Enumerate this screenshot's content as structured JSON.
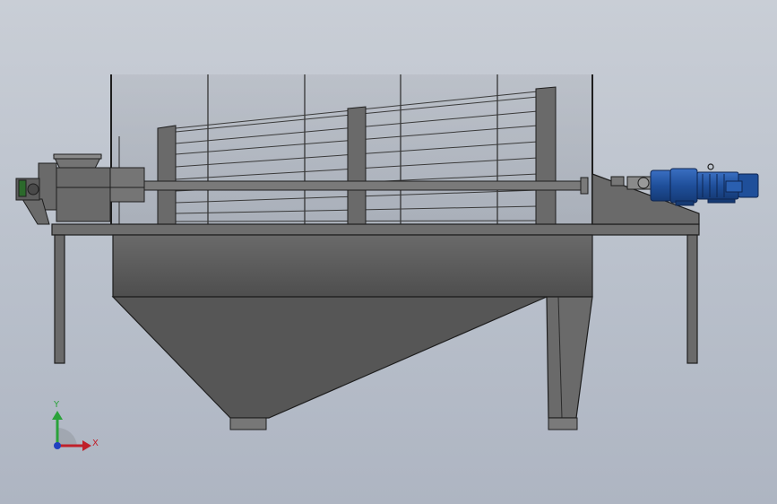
{
  "viewport": {
    "background_top": "#c9ced6",
    "background_bottom": "#aeb5c2"
  },
  "colors": {
    "steel_dark": "#5a5a5a",
    "steel_mid": "#6e6e6e",
    "steel_light": "#8a8a8a",
    "edge": "#1e1e1e",
    "motor_blue": "#1f4f9a",
    "motor_blue_dark": "#163a73",
    "axis_x": "#c0202a",
    "axis_y": "#2aa23a",
    "axis_z": "#2040c0"
  },
  "triad": {
    "x_label": "X",
    "y_label": "Y"
  },
  "icons": [
    "view-triad-icon",
    "motor-icon",
    "gear-reducer-icon"
  ]
}
